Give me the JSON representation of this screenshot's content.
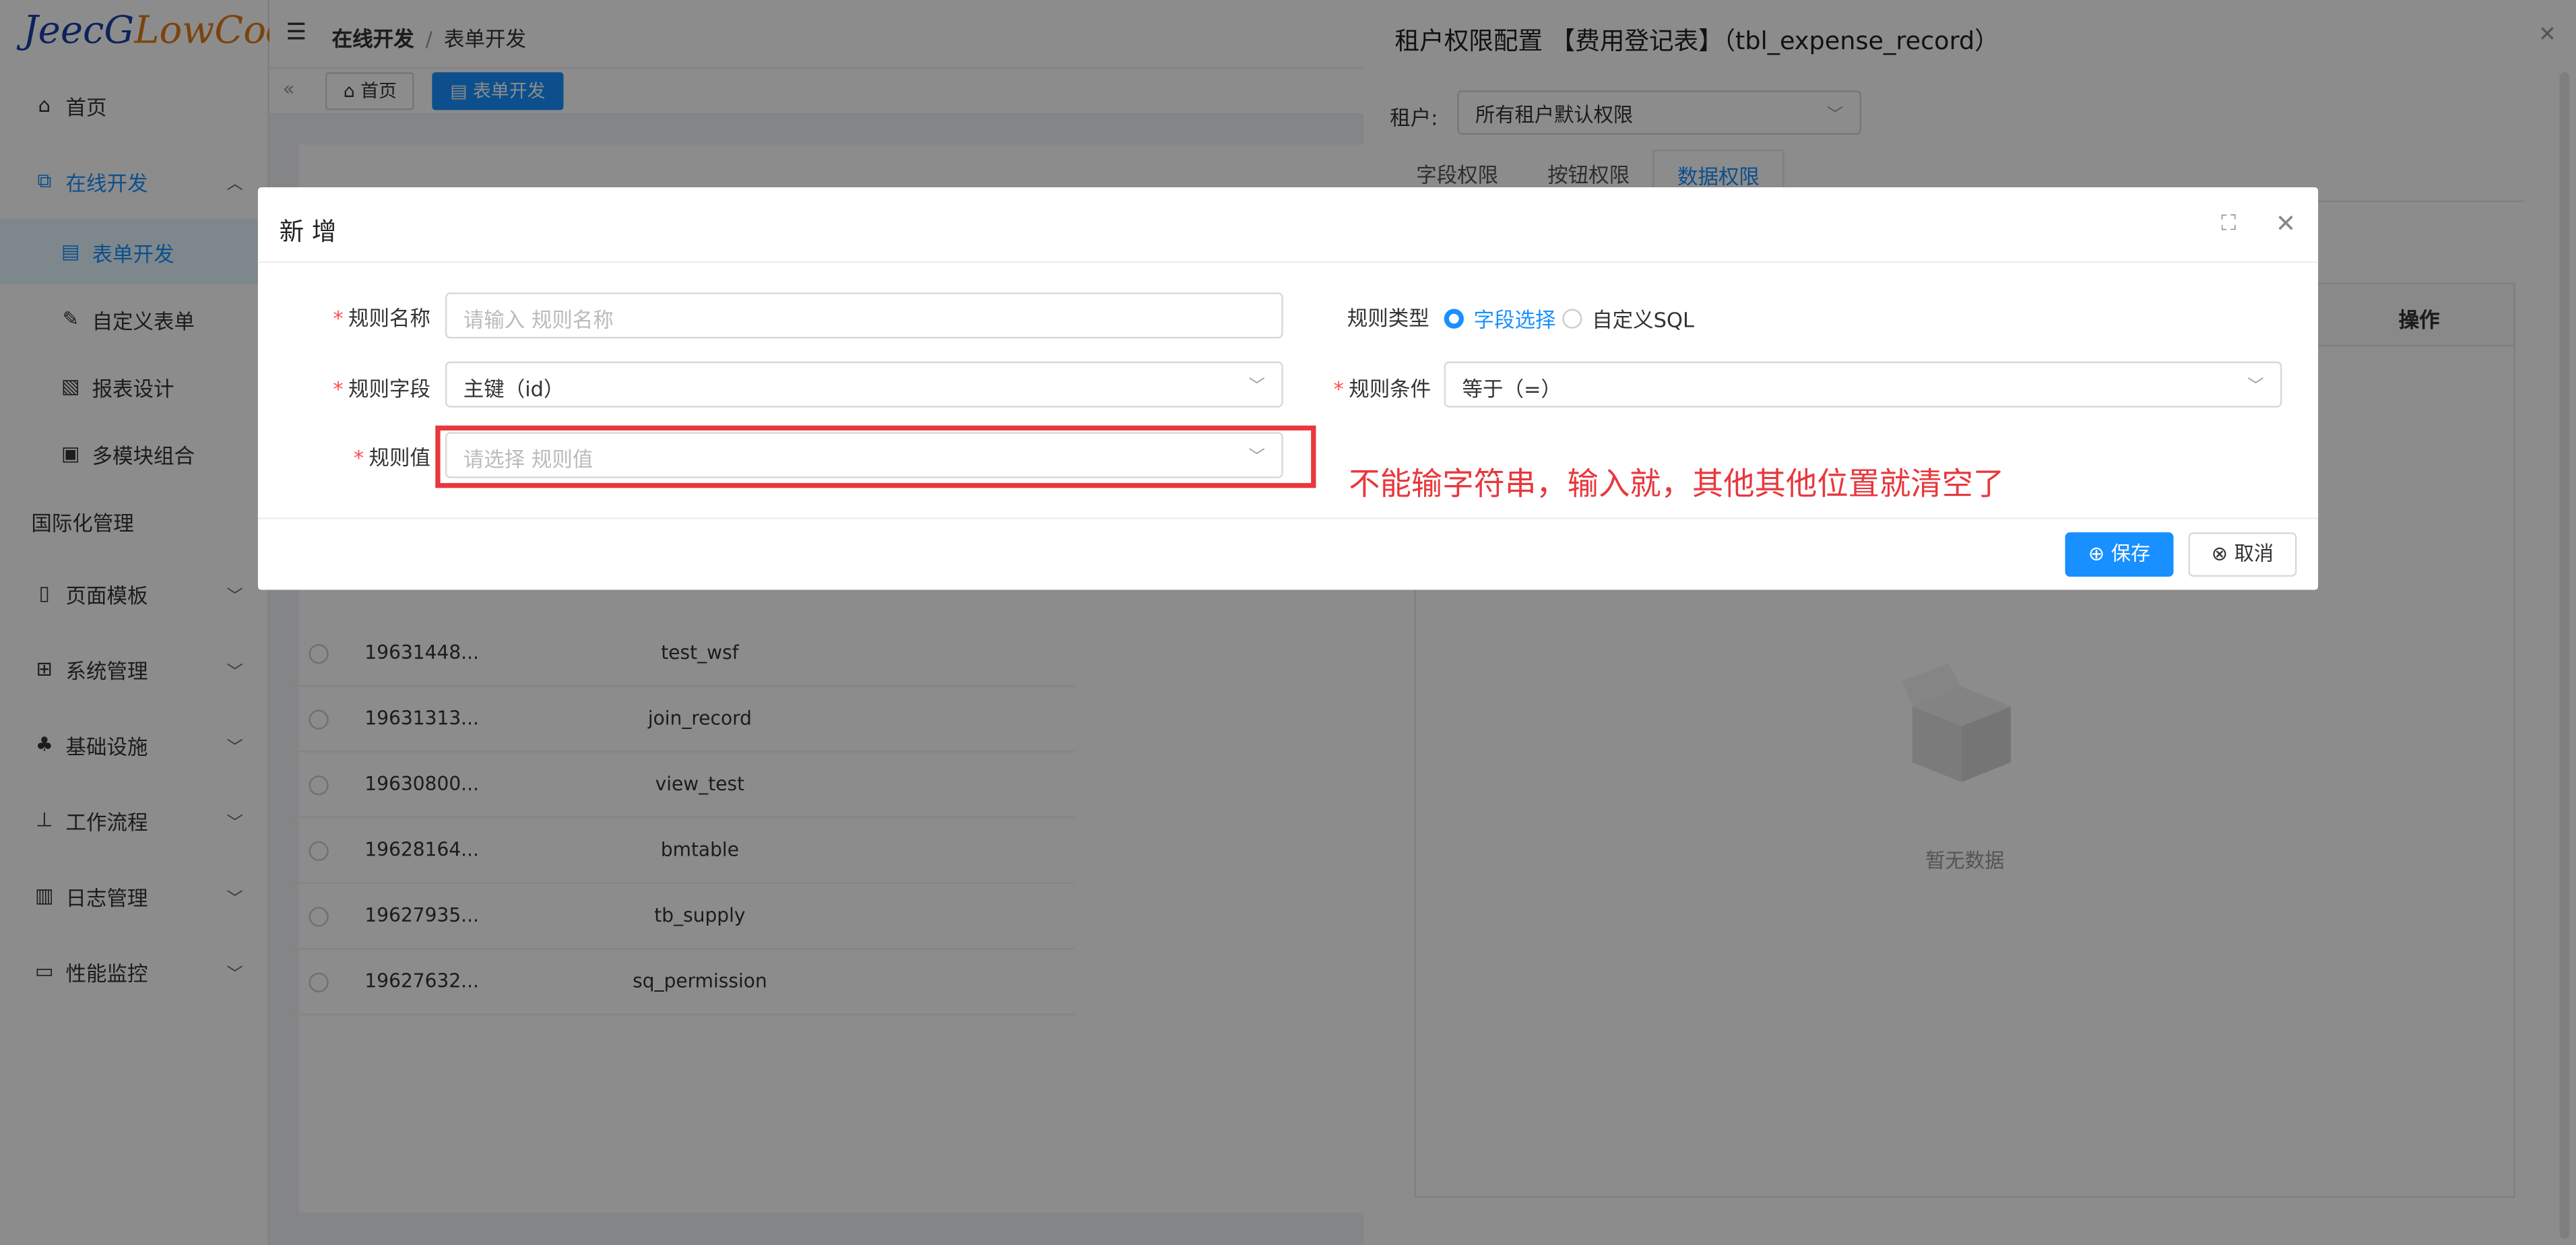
{
  "logo": {
    "part1": "JeecG",
    "part2": "LowCode"
  },
  "sidebar": {
    "items": [
      {
        "label": "首页",
        "icon": "home-icon"
      },
      {
        "label": "在线开发",
        "icon": "code-icon"
      },
      {
        "label": "表单开发",
        "icon": "form-icon"
      },
      {
        "label": "自定义表单",
        "icon": "edit-icon"
      },
      {
        "label": "报表设计",
        "icon": "report-icon"
      },
      {
        "label": "多模块组合",
        "icon": "module-icon"
      },
      {
        "label": "国际化管理",
        "icon": ""
      },
      {
        "label": "页面模板",
        "icon": "template-icon"
      },
      {
        "label": "系统管理",
        "icon": "grid-icon"
      },
      {
        "label": "基础设施",
        "icon": "infra-icon"
      },
      {
        "label": "工作流程",
        "icon": "flow-icon"
      },
      {
        "label": "日志管理",
        "icon": "log-icon"
      },
      {
        "label": "性能监控",
        "icon": "monitor-icon"
      }
    ]
  },
  "header": {
    "crumb1": "在线开发",
    "crumb_sep": "/",
    "crumb2": "表单开发"
  },
  "page_tabs": {
    "home": "首页",
    "current": "表单开发"
  },
  "table": {
    "rows": [
      {
        "id": "19631448...",
        "name": "test_wsf"
      },
      {
        "id": "19631313...",
        "name": "join_record"
      },
      {
        "id": "19630800...",
        "name": "view_test"
      },
      {
        "id": "19628164...",
        "name": "bmtable"
      },
      {
        "id": "19627935...",
        "name": "tb_supply"
      },
      {
        "id": "19627632...",
        "name": "sq_permission"
      }
    ]
  },
  "drawer": {
    "title": "租户权限配置 【费用登记表】（tbl_expense_record）",
    "tenant_label": "租户:",
    "tenant_value": "所有租户默认权限",
    "tabs": [
      "字段权限",
      "按钮权限",
      "数据权限"
    ],
    "col_action": "操作",
    "empty_text": "暂无数据"
  },
  "modal": {
    "title": "新 增",
    "req_mark": "*",
    "rule_name_label": "规则名称",
    "rule_name_placeholder": "请输入 规则名称",
    "rule_type_label": "规则类型",
    "rule_type_opt1": "字段选择",
    "rule_type_opt2": "自定义SQL",
    "rule_field_label": "规则字段",
    "rule_field_value": "主键（id）",
    "rule_cond_label": "规则条件",
    "rule_cond_value": "等于（=）",
    "rule_value_label": "规则值",
    "rule_value_placeholder": "请选择 规则值",
    "save": "保存",
    "cancel": "取消"
  },
  "annotation": "不能输字符串，输入就，其他其他位置就清空了"
}
